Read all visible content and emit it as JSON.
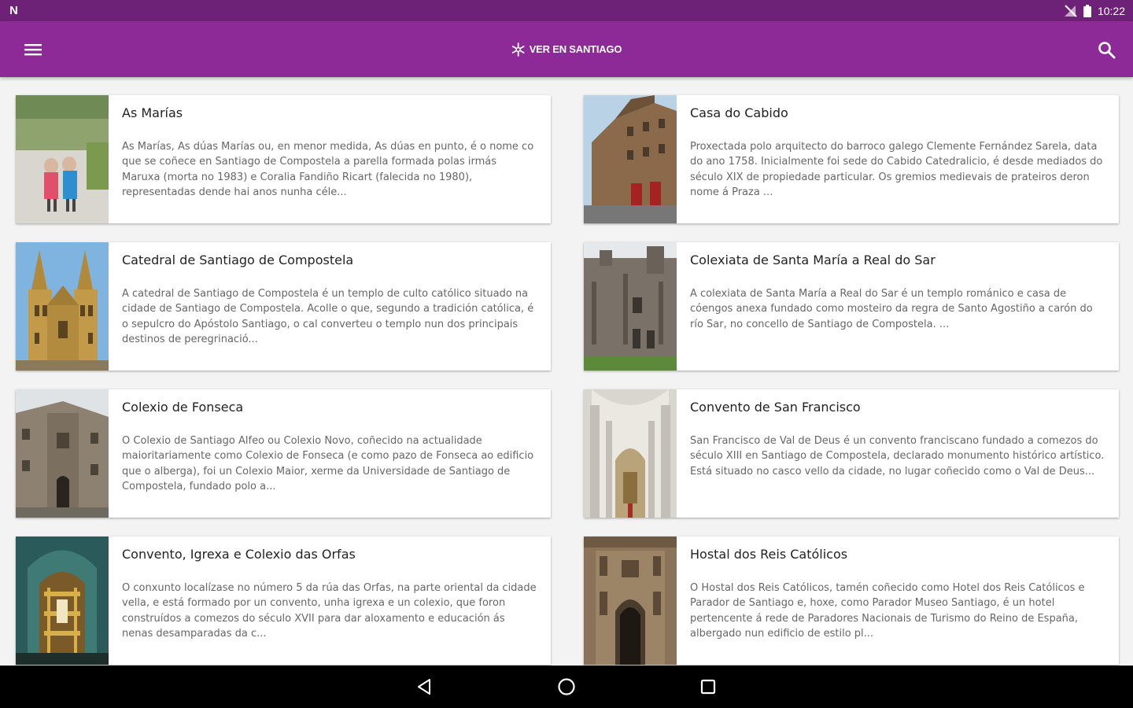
{
  "status_bar": {
    "app_badge": "N",
    "time": "10:22"
  },
  "app_bar": {
    "title": "VER EN SANTIAGO"
  },
  "colors": {
    "status_bar": "#6e2277",
    "app_bar": "#8e2a98",
    "background": "#f3f3f3"
  },
  "icons": {
    "menu": "hamburger-menu-icon",
    "search": "search-icon",
    "logo": "snowflake-logo-icon",
    "back": "back-triangle-icon",
    "home": "home-circle-icon",
    "recents": "recents-square-icon"
  },
  "places": [
    {
      "title": "As Marías",
      "description": "As Marías, As dúas Marías ou, en menor medida, As dúas en punto, é o nome co que se coñece en Santiago de Compostela a parella formada polas irmás Maruxa (morta no 1983) e Coralia Fandiño Ricart (falecida no 1980), representadas dende hai anos nunha céle..."
    },
    {
      "title": "Casa do Cabido",
      "description": "Proxectada polo arquitecto do barroco galego Clemente Fernández Sarela, data do ano 1758. Inicialmente foi sede do Cabido Catedralicio, é desde mediados do século XIX de propiedade particular. Os gremios medievais de prateiros deron nome á Praza ..."
    },
    {
      "title": "Catedral de Santiago de Compostela",
      "description": "A catedral de Santiago de Compostela é un templo de culto católico situado na cidade de Santiago de Compostela. Acolle o que, segundo a tradición católica, é o sepulcro do Apóstolo Santiago, o cal converteu o templo nun dos principais destinos de peregrinació..."
    },
    {
      "title": "Colexiata de Santa María a Real do Sar",
      "description": "A colexiata de Santa María a Real do Sar é un templo románico e casa de cóengos anexa fundado como mosteiro da regra de Santo Agostiño a carón do río Sar, no concello de Santiago de Compostela. ..."
    },
    {
      "title": "Colexio de Fonseca",
      "description": "O Colexio de Santiago Alfeo ou Colexio Novo, coñecido na actualidade maioritariamente como Colexio de Fonseca (e como pazo de Fonseca ao edificio que o alberga), foi un Colexio Maior, xerme da Universidade de Santiago de Compostela, fundado polo a..."
    },
    {
      "title": "Convento de San Francisco",
      "description": "San Francisco de Val de Deus é un convento franciscano fundado a comezos do século XIII en Santiago de Compostela, declarado monumento histórico artístico. Está situado no casco vello da cidade, no lugar coñecido como o Val de Deus..."
    },
    {
      "title": "Convento, Igrexa e Colexio das Orfas",
      "description": "O conxunto localízase no número 5 da rúa das Orfas, na parte oriental da cidade vella, e está formado por un convento, unha igrexa e un colexio, que foron construídos a comezos do século XVII para dar aloxamento e educación ás nenas desamparadas da c..."
    },
    {
      "title": "Hostal dos Reis Católicos",
      "description": "O Hostal dos Reis Católicos, tamén coñecido como Hotel dos Reis Católicos e Parador de Santiago e, hoxe, como Parador Museo Santiago, é un hotel pertencente á rede de Paradores Nacionais de Turismo do Reino de España, albergado nun edificio de estilo pl..."
    }
  ]
}
